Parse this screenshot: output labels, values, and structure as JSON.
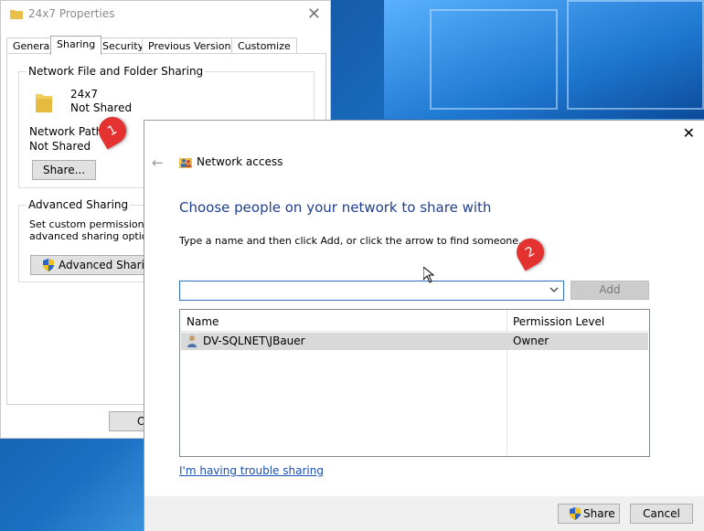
{
  "properties_window": {
    "title": "24x7 Properties",
    "tabs": [
      "General",
      "Sharing",
      "Security",
      "Previous Versions",
      "Customize"
    ],
    "active_tab": "Sharing",
    "network_group_label": "Network File and Folder Sharing",
    "folder_name": "24x7",
    "folder_status": "Not Shared",
    "network_path_label": "Network Path:",
    "network_path_value": "Not Shared",
    "share_button": "Share...",
    "advanced_group_label": "Advanced Sharing",
    "advanced_desc_line1": "Set custom permissions, cr",
    "advanced_desc_line2": "advanced sharing options.",
    "advanced_button": "Advanced Sharing...",
    "ok_button_partial": "O"
  },
  "network_dialog": {
    "title": "Network access",
    "heading": "Choose people on your network to share with",
    "instruction": "Type a name and then click Add, or click the arrow to find someone.",
    "name_input_value": "",
    "add_button": "Add",
    "columns": [
      "Name",
      "Permission Level"
    ],
    "rows": [
      {
        "name": "DV-SQLNET\\JBauer",
        "permission": "Owner"
      }
    ],
    "trouble_link": "I'm having trouble sharing",
    "share_button": "Share",
    "cancel_button": "Cancel"
  },
  "annotations": {
    "badge_1": "1",
    "badge_2": "2"
  },
  "colors": {
    "accent_blue": "#1f3f8f",
    "link_blue": "#1a4fb3",
    "badge_red": "#e3322f"
  }
}
